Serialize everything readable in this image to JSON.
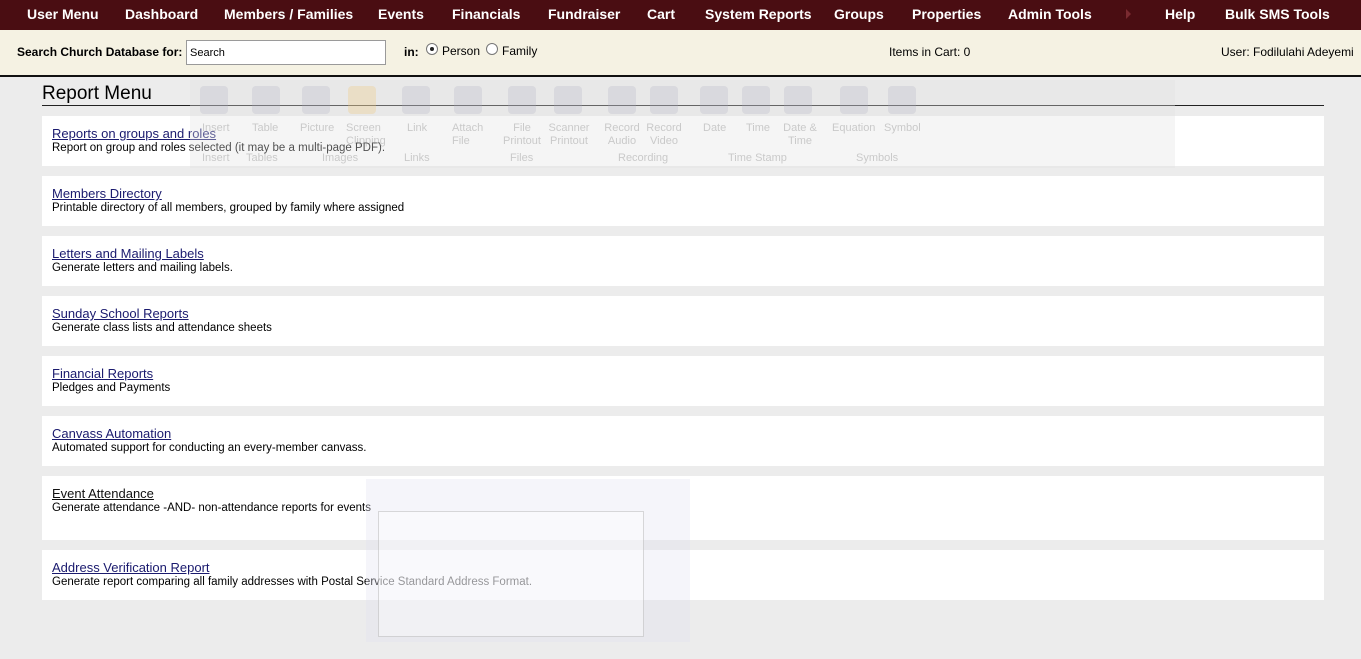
{
  "nav": {
    "items": [
      "User Menu",
      "Dashboard",
      "Members / Families",
      "Events",
      "Financials",
      "Fundraiser",
      "Cart",
      "System Reports",
      "Groups",
      "Properties",
      "Admin Tools",
      "Help",
      "Bulk SMS Tools"
    ]
  },
  "search": {
    "label": "Search Church Database for:",
    "value": "Search",
    "in_label": "in:",
    "options": [
      "Person",
      "Family"
    ],
    "selected": "Person"
  },
  "cart": {
    "text": "Items in Cart: 0"
  },
  "user": {
    "text": "User: Fodilulahi Adeyemi"
  },
  "page": {
    "title": "Report Menu"
  },
  "reports": [
    {
      "title": "Reports on groups and roles",
      "desc": "Report on group and roles selected (it may be a multi-page PDF)."
    },
    {
      "title": "Members Directory",
      "desc": "Printable directory of all members, grouped by family where assigned"
    },
    {
      "title": "Letters and Mailing Labels",
      "desc": "Generate letters and mailing labels."
    },
    {
      "title": "Sunday School Reports",
      "desc": "Generate class lists and attendance sheets"
    },
    {
      "title": "Financial Reports",
      "desc": "Pledges and Payments"
    },
    {
      "title": "Canvass Automation",
      "desc": "Automated support for conducting an every-member canvass."
    },
    {
      "title": "Event Attendance",
      "desc": "Generate attendance -AND- non-attendance reports for events"
    },
    {
      "title": "Address Verification Report",
      "desc": "Generate report comparing all family addresses with Postal Service Standard Address Format."
    }
  ],
  "ghost_ribbon": {
    "labels": [
      "Insert",
      "Table",
      "Picture",
      "Screen Clipping",
      "Link",
      "Attach File",
      "File Printout",
      "Scanner Printout",
      "Record Audio",
      "Record Video",
      "Date",
      "Time",
      "Date & Time",
      "Equation",
      "Symbol"
    ],
    "groups": [
      "Insert",
      "Tables",
      "Images",
      "Links",
      "Files",
      "Recording",
      "Time Stamp",
      "Symbols"
    ]
  },
  "colors": {
    "nav_bg": "#4a0d12",
    "search_bg": "#f5f2e3",
    "link": "#1a1a6e",
    "page_bg": "#ececec"
  }
}
